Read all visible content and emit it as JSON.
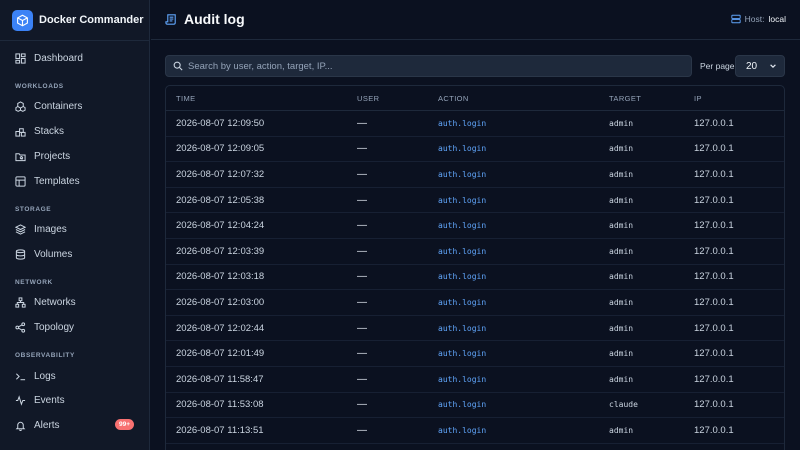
{
  "app": {
    "name": "Docker Commander"
  },
  "sidebar": {
    "dashboard": {
      "label": "Dashboard",
      "icon": "dashboard-icon"
    },
    "sections": [
      {
        "title": "WORKLOADS",
        "items": [
          {
            "label": "Containers",
            "icon": "containers-icon"
          },
          {
            "label": "Stacks",
            "icon": "stacks-icon"
          },
          {
            "label": "Projects",
            "icon": "folder-icon"
          },
          {
            "label": "Templates",
            "icon": "templates-icon"
          }
        ]
      },
      {
        "title": "STORAGE",
        "items": [
          {
            "label": "Images",
            "icon": "layers-icon"
          },
          {
            "label": "Volumes",
            "icon": "database-icon"
          }
        ]
      },
      {
        "title": "NETWORK",
        "items": [
          {
            "label": "Networks",
            "icon": "network-icon"
          },
          {
            "label": "Topology",
            "icon": "share-icon"
          }
        ]
      },
      {
        "title": "OBSERVABILITY",
        "items": [
          {
            "label": "Logs",
            "icon": "terminal-icon"
          },
          {
            "label": "Events",
            "icon": "activity-icon"
          },
          {
            "label": "Alerts",
            "icon": "bell-icon",
            "badge": "99+"
          }
        ]
      }
    ]
  },
  "header": {
    "title": "Audit log",
    "host_label": "Host:",
    "host_value": "local"
  },
  "filters": {
    "search_placeholder": "Search by user, action, target, IP...",
    "search_value": "",
    "per_page_label": "Per page",
    "per_page_value": "20"
  },
  "table": {
    "columns": [
      "TIME",
      "USER",
      "ACTION",
      "TARGET",
      "IP"
    ],
    "rows": [
      {
        "time": "2026-08-07 12:09:50",
        "user": "—",
        "action": "auth.login",
        "target": "admin",
        "ip": "127.0.0.1"
      },
      {
        "time": "2026-08-07 12:09:05",
        "user": "—",
        "action": "auth.login",
        "target": "admin",
        "ip": "127.0.0.1"
      },
      {
        "time": "2026-08-07 12:07:32",
        "user": "—",
        "action": "auth.login",
        "target": "admin",
        "ip": "127.0.0.1"
      },
      {
        "time": "2026-08-07 12:05:38",
        "user": "—",
        "action": "auth.login",
        "target": "admin",
        "ip": "127.0.0.1"
      },
      {
        "time": "2026-08-07 12:04:24",
        "user": "—",
        "action": "auth.login",
        "target": "admin",
        "ip": "127.0.0.1"
      },
      {
        "time": "2026-08-07 12:03:39",
        "user": "—",
        "action": "auth.login",
        "target": "admin",
        "ip": "127.0.0.1"
      },
      {
        "time": "2026-08-07 12:03:18",
        "user": "—",
        "action": "auth.login",
        "target": "admin",
        "ip": "127.0.0.1"
      },
      {
        "time": "2026-08-07 12:03:00",
        "user": "—",
        "action": "auth.login",
        "target": "admin",
        "ip": "127.0.0.1"
      },
      {
        "time": "2026-08-07 12:02:44",
        "user": "—",
        "action": "auth.login",
        "target": "admin",
        "ip": "127.0.0.1"
      },
      {
        "time": "2026-08-07 12:01:49",
        "user": "—",
        "action": "auth.login",
        "target": "admin",
        "ip": "127.0.0.1"
      },
      {
        "time": "2026-08-07 11:58:47",
        "user": "—",
        "action": "auth.login",
        "target": "admin",
        "ip": "127.0.0.1"
      },
      {
        "time": "2026-08-07 11:53:08",
        "user": "—",
        "action": "auth.login",
        "target": "claude",
        "ip": "127.0.0.1"
      },
      {
        "time": "2026-08-07 11:13:51",
        "user": "—",
        "action": "auth.login",
        "target": "admin",
        "ip": "127.0.0.1"
      }
    ]
  },
  "colors": {
    "background": "#0b1120",
    "sidebar": "#111827",
    "accent": "#3b82f6",
    "action_text": "#60a5fa",
    "badge": "#f87171"
  }
}
